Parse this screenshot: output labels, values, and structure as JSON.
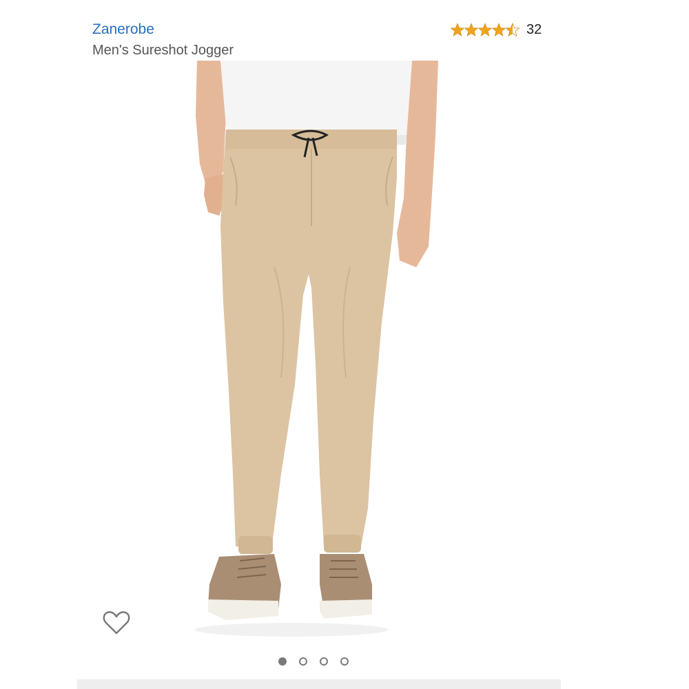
{
  "product": {
    "brand": "Zanerobe",
    "title": "Men's Sureshot Jogger",
    "rating": {
      "stars": 4.5,
      "max_stars": 5,
      "count": "32",
      "star_color": "#f0a41b"
    }
  },
  "carousel": {
    "total": 4,
    "active_index": 0
  },
  "icons": {
    "wishlist": "heart-outline-icon"
  },
  "colors": {
    "brand_link": "#2a6ebb",
    "title": "#555555",
    "pants": "#dcc3a2",
    "shoes": "#a98e74"
  }
}
